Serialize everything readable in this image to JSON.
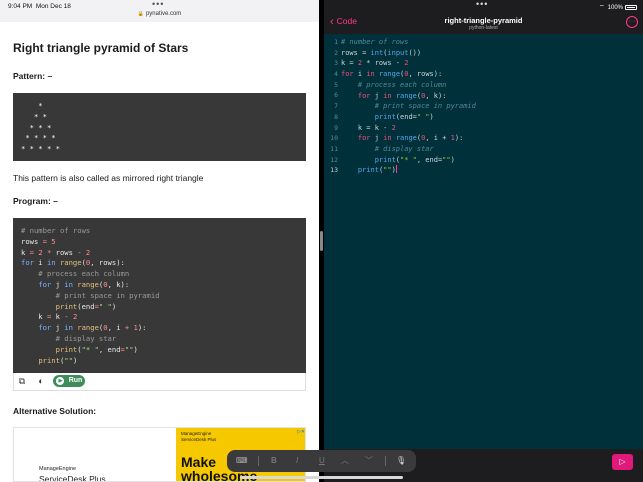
{
  "browser": {
    "time": "9:04 PM",
    "date": "Mon Dec 18",
    "url": "pynative.com",
    "title": "Right triangle pyramid of Stars",
    "pattern_label": "Pattern: –",
    "pattern_lines": "    *\n   * *\n  * * *\n * * * *\n* * * * *",
    "description": "This pattern is also called as mirrored right triangle",
    "program_label": "Program: –",
    "code_lines": [
      "# number of rows",
      "rows = 5",
      "k = 2 * rows - 2",
      "for i in range(0, rows):",
      "    # process each column",
      "    for j in range(0, k):",
      "        # print space in pyramid",
      "        print(end=\" \")",
      "    k = k - 2",
      "    for j in range(0, i + 1):",
      "        # display star",
      "        print(\"* \", end=\"\")",
      "    print(\"\")"
    ],
    "run_label": "Run",
    "alt_label": "Alternative Solution:",
    "ad": {
      "brand": "ManageEngine",
      "product": "ServiceDesk Plus",
      "small_brand": "ManageEngine",
      "small_product": "ServiceDesk Plus",
      "headline_1": "Make",
      "headline_2": "wholesome"
    }
  },
  "editor": {
    "back_label": "Code",
    "file_name": "right-triangle-pyramid",
    "runtime": "python-latest",
    "battery": "100%",
    "accent": "#ff3b8a",
    "line_numbers": [
      "1",
      "2",
      "3",
      "4",
      "5",
      "6",
      "7",
      "8",
      "9",
      "10",
      "11",
      "12",
      "13"
    ],
    "current_line": "13",
    "code_lines": [
      "# number of rows",
      "rows = int(input())",
      "k = 2 * rows - 2",
      "for i in range(0, rows):",
      "    # process each column",
      "    for j in range(0, k):",
      "        # print space in pyramid",
      "        print(end=\" \")",
      "    k = k - 2",
      "    for j in range(0, i + 1):",
      "        # display star",
      "        print(\"* \", end=\"\")",
      "    print(\"\")"
    ],
    "keyboard_bar": {
      "keyboard_icon": "keyboard-icon",
      "bold": "B",
      "italic": "I",
      "underline": "U",
      "mic_icon": "mic-icon"
    }
  }
}
